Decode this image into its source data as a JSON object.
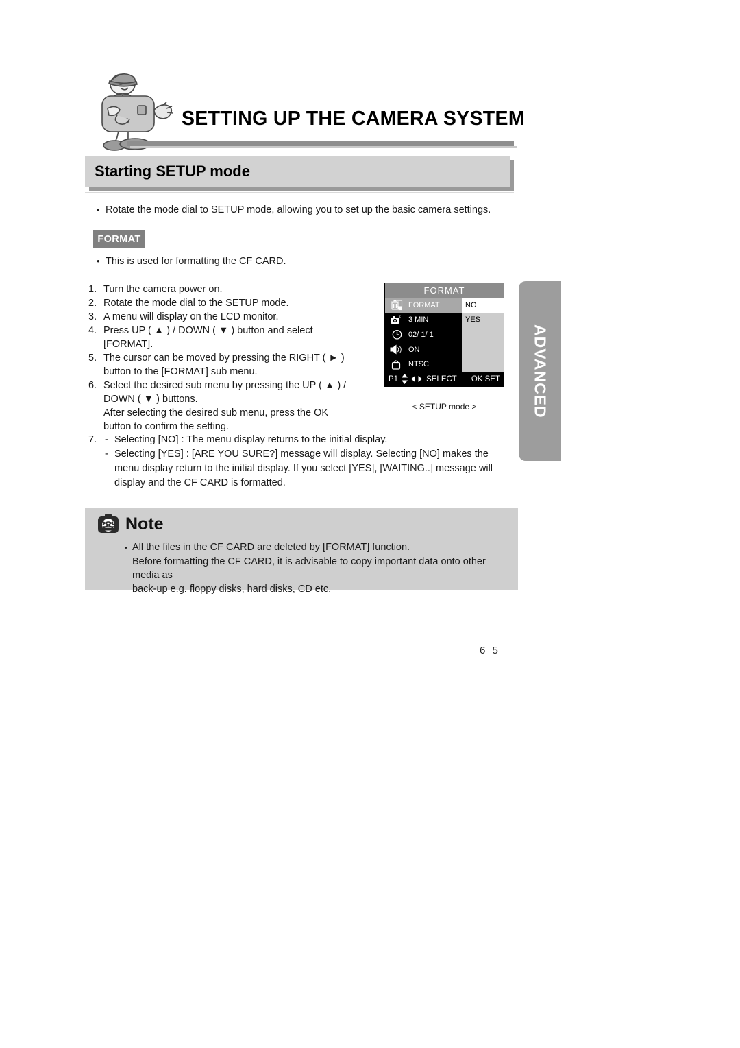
{
  "header": {
    "title": "SETTING UP THE CAMERA SYSTEM",
    "mascot_icon": "camera-mascot-illustration"
  },
  "section": {
    "title": "Starting SETUP mode"
  },
  "intro": {
    "bullet": "•",
    "text": "Rotate the mode dial to SETUP mode, allowing you to set up the basic camera settings."
  },
  "format_badge": {
    "label": "FORMAT"
  },
  "format_desc": {
    "bullet": "•",
    "text": "This is used for formatting the CF CARD."
  },
  "steps": [
    {
      "num": "1.",
      "lines": [
        "Turn the camera power on."
      ]
    },
    {
      "num": "2.",
      "lines": [
        "Rotate the mode dial to the SETUP mode."
      ]
    },
    {
      "num": "3.",
      "lines": [
        "A menu will display on the LCD monitor."
      ]
    },
    {
      "num": "4.",
      "lines": [
        "Press UP ( ▲ ) / DOWN ( ▼ ) button and select",
        "[FORMAT]."
      ]
    },
    {
      "num": "5.",
      "lines": [
        "The cursor can be moved by pressing the RIGHT ( ► )",
        "button to the [FORMAT] sub menu."
      ]
    },
    {
      "num": "6.",
      "lines": [
        "Select the desired sub menu by pressing the UP ( ▲ ) /",
        "DOWN ( ▼ ) buttons.",
        "After selecting the desired sub menu, press the OK",
        "button to confirm the setting."
      ]
    }
  ],
  "step7": {
    "num": "7.",
    "dash": "-",
    "items": [
      [
        "Selecting [NO] : The menu display returns to the initial display."
      ],
      [
        "Selecting [YES] : [ARE YOU SURE?] message will display. Selecting [NO] makes the",
        "menu display return to the initial display. If you select [YES], [WAITING..] message will",
        "display and the CF CARD is formatted."
      ]
    ]
  },
  "lcd": {
    "title": "FORMAT",
    "rows": [
      {
        "icon": "trash-format-icon",
        "label": "FORMAT",
        "selected": true
      },
      {
        "icon": "camera-sleep-icon",
        "label": "3 MIN",
        "selected": false
      },
      {
        "icon": "clock-icon",
        "label": "02/ 1/ 1",
        "selected": false
      },
      {
        "icon": "speaker-icon",
        "label": "ON",
        "selected": false
      },
      {
        "icon": "tv-icon",
        "label": "NTSC",
        "selected": false
      }
    ],
    "submenu": [
      {
        "label": "NO",
        "active": true
      },
      {
        "label": "YES",
        "active": false
      }
    ],
    "footer": {
      "page": "P1",
      "updown_icon": "up-down-arrows-icon",
      "leftright_icon": "left-right-arrows-icon",
      "select_label": "SELECT",
      "ok_label": "OK SET"
    },
    "caption": "< SETUP mode >"
  },
  "advanced_tab": {
    "label": "ADVANCED"
  },
  "note": {
    "icon": "note-camera-icon",
    "title": "Note",
    "bullet": "•",
    "lines": [
      "All the files in the CF CARD are deleted by [FORMAT] function.",
      "Before formatting the CF CARD, it is advisable to copy important data onto other media as",
      "back-up e.g. floppy disks, hard disks, CD etc."
    ]
  },
  "footer": {
    "page_number": "6 5"
  },
  "colors": {
    "section_bar": "#d2d2d2",
    "section_bar_shadow": "#9a9a9a",
    "badge_gray": "#808080",
    "note_bg": "#cfcfcf",
    "tab_gray": "#9d9d9d",
    "lcd_black": "#000000",
    "lcd_title_gray": "#8c8c8c",
    "lcd_submenu_gray": "#cccccc"
  }
}
